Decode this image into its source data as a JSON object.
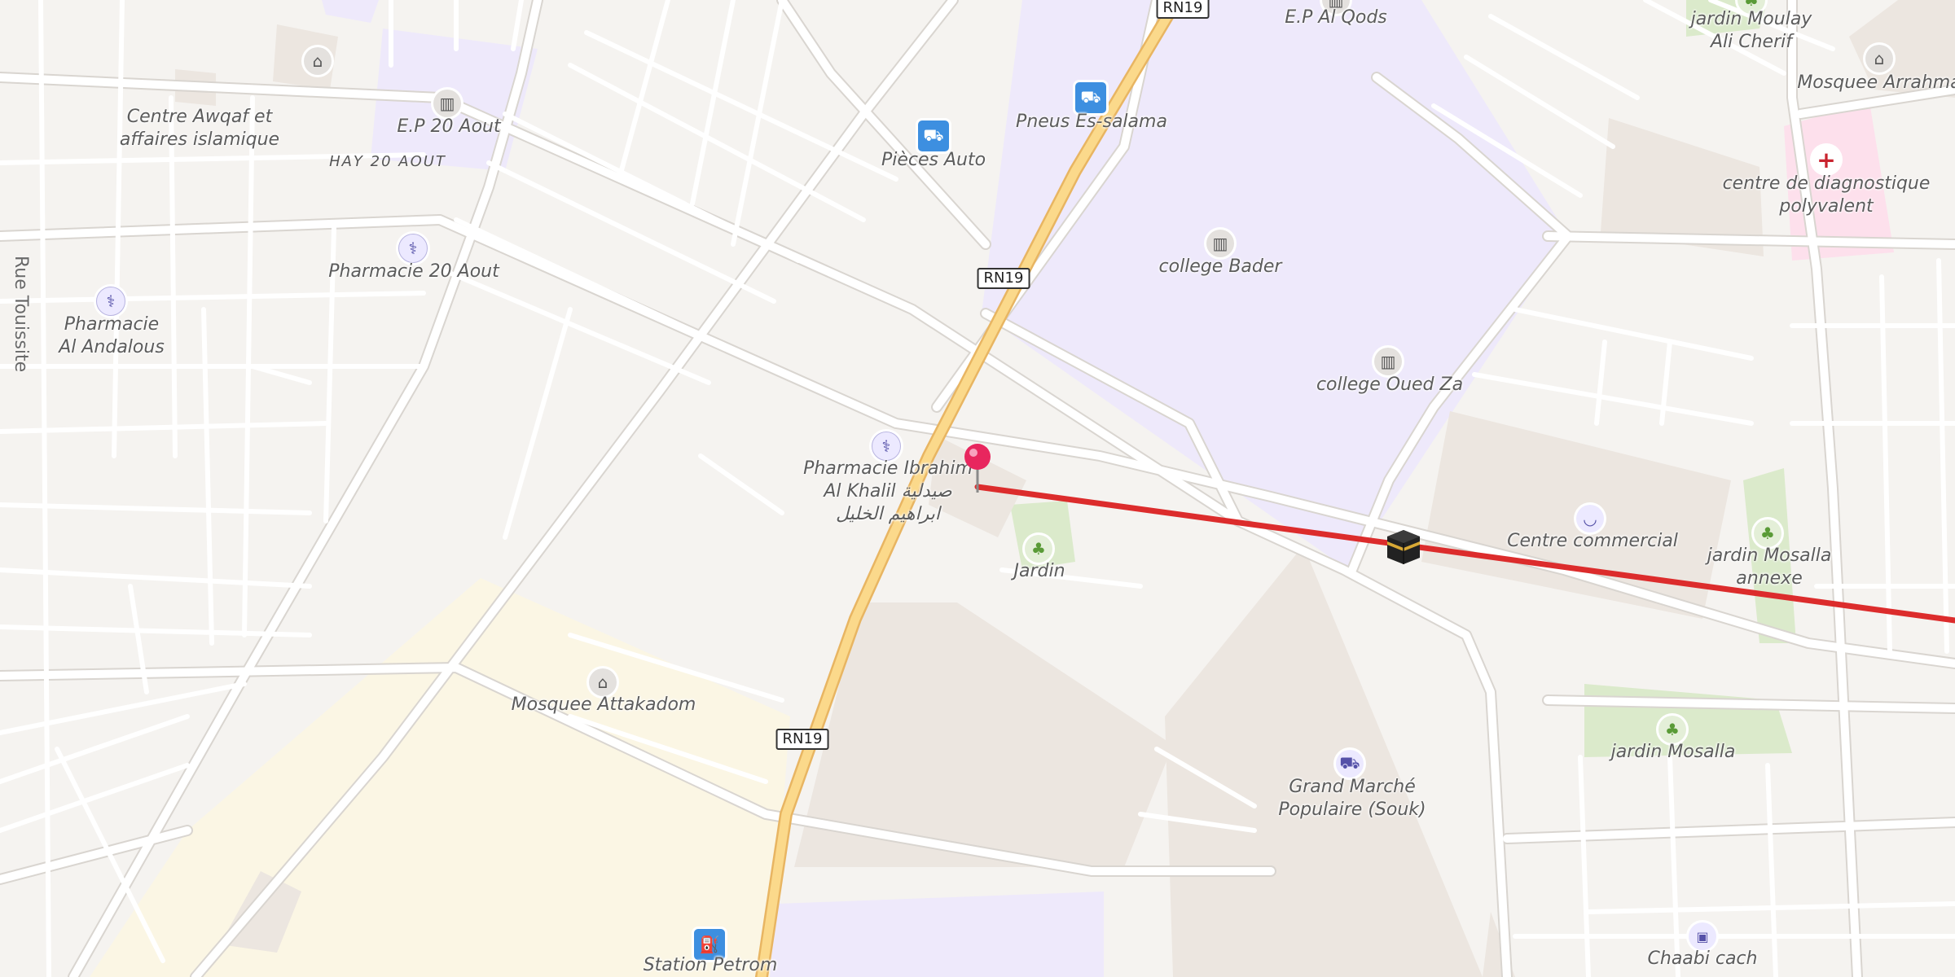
{
  "colors": {
    "route": "#dc2c2c",
    "highway": "#fbd98b",
    "school_zone": "#eee9fb",
    "park": "#dbeacb",
    "hospital": "#fde0ec",
    "residential": "#fbf6e4",
    "pin": "#e8265e"
  },
  "road_shields": [
    {
      "text": "RN19"
    },
    {
      "text": "RN19"
    },
    {
      "text": "RN19"
    }
  ],
  "labels": {
    "ep_al_qods": "E.P Al Qods",
    "jardin_moulay_1": "jardin Moulay",
    "jardin_moulay_2": "Ali Cherif",
    "mosquee_arrahma": "Mosquee Arrahma",
    "centre_awqaf_1": "Centre Awqaf et",
    "centre_awqaf_2": "affaires islamique",
    "ep_20_aout": "E.P 20 Aout",
    "hay_20_aout": "HAY 20 AOUT",
    "pneus": "Pneus Es-salama",
    "pieces_auto": "Pièces Auto",
    "centre_diag_1": "centre de diagnostique",
    "centre_diag_2": "polyvalent",
    "college_bader": "college Bader",
    "pharmacie_20_aout": "Pharmacie 20 Aout",
    "rue_touissite": "Rue Touissite",
    "pharmacie_andalous_1": "Pharmacie",
    "pharmacie_andalous_2": "Al Andalous",
    "college_oued_za": "college Oued Za",
    "pharmacie_ibrahim_1": "Pharmacie Ibrahim",
    "pharmacie_ibrahim_2": "Al Khalil صيدلية",
    "pharmacie_ibrahim_3": "ابراهيم الخليل",
    "jardin": "Jardin",
    "centre_commercial": "Centre commercial",
    "jardin_mosalla_annexe_1": "jardin Mosalla",
    "jardin_mosalla_annexe_2": "annexe",
    "mosquee_attakadom": "Mosquee Attakadom",
    "grand_marche_1": "Grand Marché",
    "grand_marche_2": "Populaire (Souk)",
    "jardin_mosalla": "jardin Mosalla",
    "station_petrom": "Station Petrom",
    "chaabi_cash": "Chaabi cach"
  },
  "icons": {
    "mosque": "mosque-icon",
    "school": "school-icon",
    "pharmacy": "pharmacy-icon",
    "car": "car-icon",
    "fuel": "fuel-icon",
    "park": "tree-icon",
    "shop": "shopping-basket-icon",
    "cart": "shopping-cart-icon",
    "hospital": "hospital-cross-icon",
    "bank": "bank-note-icon",
    "pin": "location-pin-icon",
    "qibla": "kaaba-icon"
  }
}
